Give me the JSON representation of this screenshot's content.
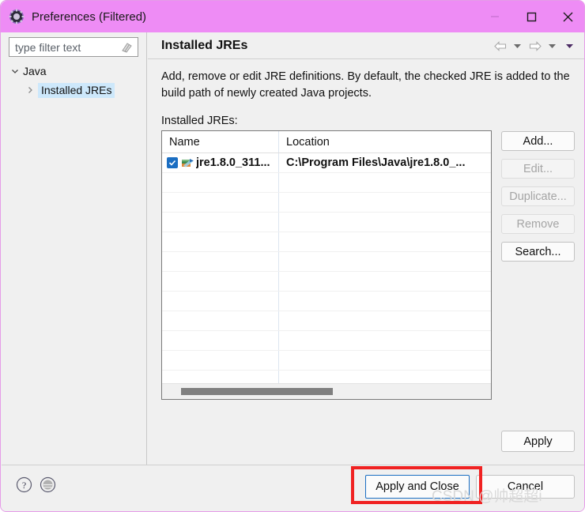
{
  "window": {
    "title": "Preferences (Filtered)",
    "icon": "preferences-gear-icon",
    "titlebar_color": "#ee8cf5",
    "controls": {
      "minimize": "—",
      "maximize": "□",
      "close": "✕"
    }
  },
  "sidebar": {
    "filter": {
      "value": "",
      "placeholder": "type filter text",
      "clear_icon": "eraser-icon"
    },
    "tree": [
      {
        "label": "Java",
        "expanded": true,
        "chevron": "chevron-down-icon",
        "selected": false,
        "indent": 0
      },
      {
        "label": "Installed JREs",
        "expanded": false,
        "chevron": "chevron-right-icon",
        "selected": true,
        "indent": 1
      }
    ]
  },
  "page": {
    "title": "Installed JREs",
    "description": "Add, remove or edit JRE definitions. By default, the checked JRE is added to the build path of newly created Java projects.",
    "list_label": "Installed JREs:",
    "nav_icons": [
      "back-arrow-icon",
      "back-dropdown-icon",
      "forward-arrow-icon",
      "forward-dropdown-icon",
      "view-menu-icon"
    ]
  },
  "table": {
    "columns": [
      "Name",
      "Location"
    ],
    "rows": [
      {
        "checked": true,
        "icon": "jre-library-icon",
        "name": "jre1.8.0_311...",
        "location": "C:\\Program Files\\Java\\jre1.8.0_..."
      }
    ],
    "empty_row_count": 11,
    "scrollbar": {
      "orientation": "horizontal",
      "thumb_color": "#808080"
    }
  },
  "side_buttons": [
    {
      "label": "Add...",
      "enabled": true
    },
    {
      "label": "Edit...",
      "enabled": false
    },
    {
      "label": "Duplicate...",
      "enabled": false
    },
    {
      "label": "Remove",
      "enabled": false
    },
    {
      "label": "Search...",
      "enabled": true
    }
  ],
  "apply_button": {
    "label": "Apply",
    "enabled": true
  },
  "footer": {
    "help_icon": "help-question-icon",
    "secondary_icon": "globe-icon",
    "apply_and_close": {
      "label": "Apply and Close",
      "focused": true,
      "highlight_color": "#f02222"
    },
    "cancel": {
      "label": "Cancel"
    },
    "watermark": "CSDN @帅超超i"
  }
}
